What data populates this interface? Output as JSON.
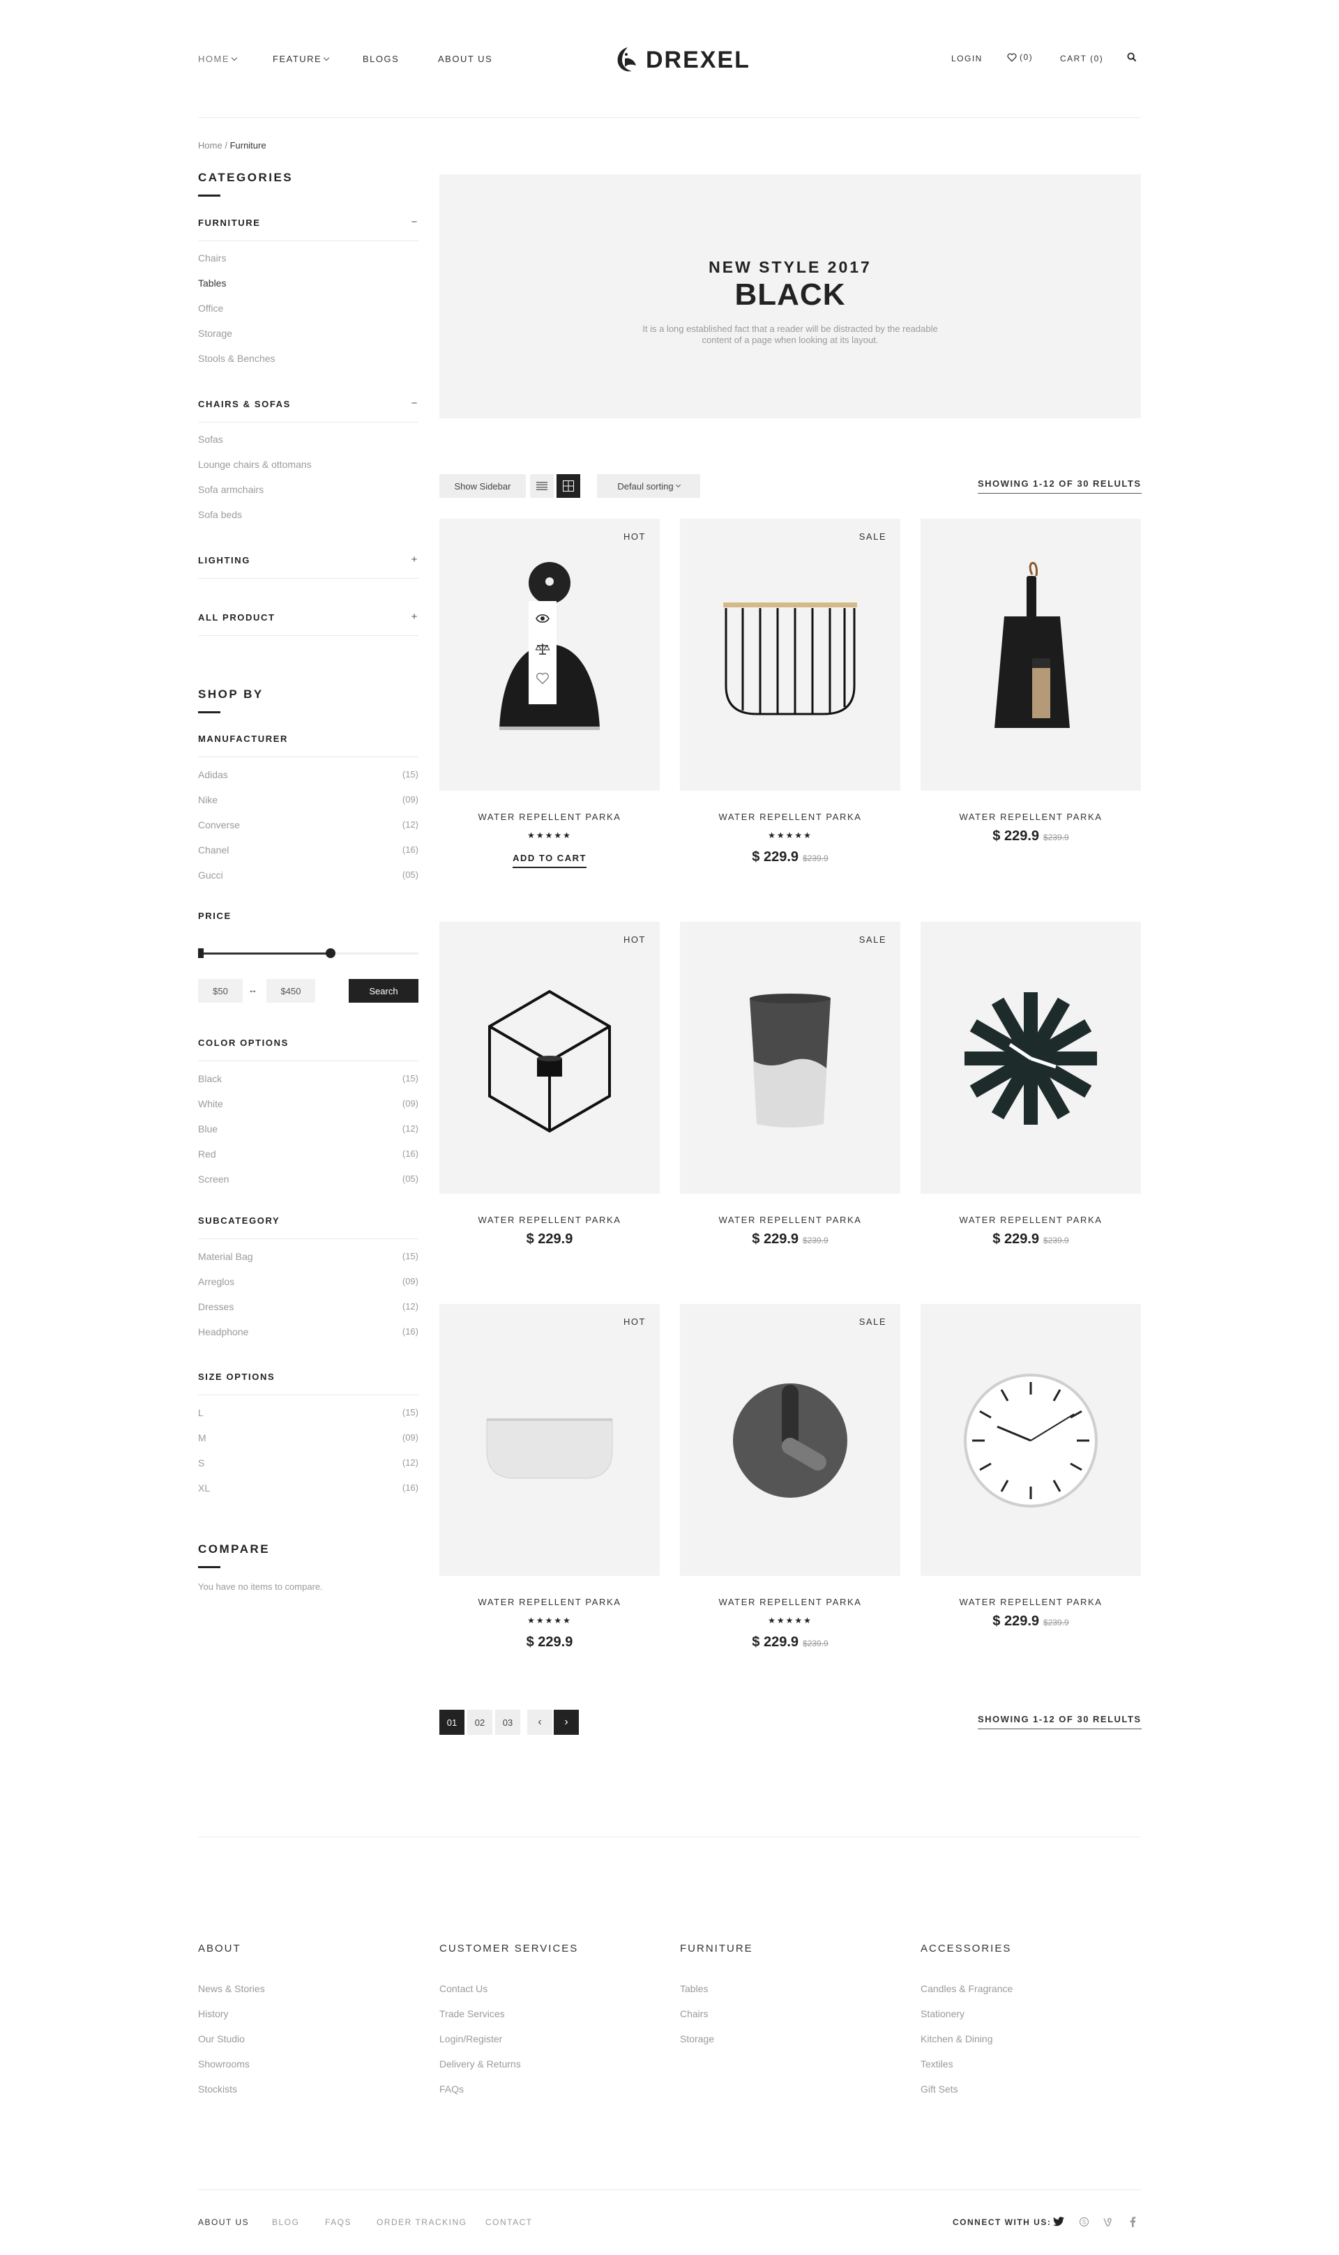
{
  "header": {
    "nav": [
      "HOME",
      "FEATURE",
      "BLOGS",
      "ABOUT US"
    ],
    "logo": "DREXEL",
    "login": "LOGIN",
    "wishlist": "(0)",
    "cart": "CART (0)",
    "icons": [
      "heart-icon",
      "search-icon",
      "logo-mark-icon"
    ]
  },
  "breadcrumb": {
    "home": "Home",
    "sep": "/",
    "current": "Furniture"
  },
  "sidebar": {
    "categories_title": "CATEGORIES",
    "groups": [
      {
        "title": "FURNITURE",
        "sign": "−",
        "items": [
          "Chairs",
          "Tables",
          "Office",
          "Storage",
          "Stools & Benches"
        ]
      },
      {
        "title": "CHAIRS & SOFAS",
        "sign": "−",
        "items": [
          "Sofas",
          "Lounge chairs & ottomans",
          "Sofa armchairs",
          "Sofa beds"
        ]
      },
      {
        "title": "LIGHTING",
        "sign": "+"
      },
      {
        "title": "ALL PRODUCT",
        "sign": "+"
      }
    ],
    "shop_by_title": "SHOP BY",
    "manufacturer": {
      "title": "MANUFACTURER",
      "items": [
        {
          "name": "Adidas",
          "count": "(15)"
        },
        {
          "name": "Nike",
          "count": "(09)"
        },
        {
          "name": "Converse",
          "count": "(12)"
        },
        {
          "name": "Chanel",
          "count": "(16)"
        },
        {
          "name": "Gucci",
          "count": "(05)"
        }
      ]
    },
    "price": {
      "title": "PRICE",
      "min": "$50",
      "sep": "↔",
      "max": "$450",
      "search_label": "Search",
      "range_fill": 0.6
    },
    "color": {
      "title": "COLOR OPTIONS",
      "items": [
        {
          "name": "Black",
          "count": "(15)"
        },
        {
          "name": "White",
          "count": "(09)"
        },
        {
          "name": "Blue",
          "count": "(12)"
        },
        {
          "name": "Red",
          "count": "(16)"
        },
        {
          "name": "Screen",
          "count": "(05)"
        }
      ]
    },
    "subcategory": {
      "title": "SUBCATEGORY",
      "items": [
        {
          "name": "Material Bag",
          "count": "(15)"
        },
        {
          "name": "Arreglos",
          "count": "(09)"
        },
        {
          "name": "Dresses",
          "count": "(12)"
        },
        {
          "name": "Headphone",
          "count": "(16)"
        }
      ]
    },
    "size": {
      "title": "SIZE OPTIONS",
      "items": [
        {
          "name": "L",
          "count": "(15)"
        },
        {
          "name": "M",
          "count": "(09)"
        },
        {
          "name": "S",
          "count": "(12)"
        },
        {
          "name": "XL",
          "count": "(16)"
        }
      ]
    },
    "compare": {
      "title": "COMPARE",
      "text": "You have no items to compare."
    }
  },
  "banner": {
    "subtitle": "NEW STYLE 2017",
    "title": "BLACK",
    "desc_line1": "It is a long established fact that a reader will be distracted by the readable",
    "desc_line2": "content of a page when looking at its layout."
  },
  "toolbar": {
    "show_sidebar": "Show Sidebar",
    "sort": "Defaul sorting",
    "showing": "SHOWING 1-12 OF 30 RELULTS",
    "active_view": "grid"
  },
  "products": [
    {
      "name": "WATER REPELLENT PARKA",
      "badge": "HOT",
      "stars": "★★★★★",
      "add_to_cart": "ADD TO CART",
      "image": "wall-lamp"
    },
    {
      "name": "WATER REPELLENT PARKA",
      "badge": "SALE",
      "stars": "★★★★★",
      "price": "$ 229.9",
      "old_price": "$239.9",
      "image": "wire-shelf"
    },
    {
      "name": "WATER REPELLENT PARKA",
      "price": "$ 229.9",
      "old_price": "$239.9",
      "image": "dustpan"
    },
    {
      "name": "WATER REPELLENT PARKA",
      "badge": "HOT",
      "price": "$ 229.9",
      "image": "cube-candle"
    },
    {
      "name": "WATER REPELLENT PARKA",
      "badge": "SALE",
      "price": "$ 229.9",
      "old_price": "$239.9",
      "image": "cup"
    },
    {
      "name": "WATER REPELLENT PARKA",
      "price": "$ 229.9",
      "old_price": "$239.9",
      "image": "asterisk-clock"
    },
    {
      "name": "WATER REPELLENT PARKA",
      "badge": "HOT",
      "stars": "★★★★★",
      "price": "$ 229.9",
      "image": "bowl-shelf"
    },
    {
      "name": "WATER REPELLENT PARKA",
      "badge": "SALE",
      "stars": "★★★★★",
      "price": "$ 229.9",
      "old_price": "$239.9",
      "image": "grey-clock"
    },
    {
      "name": "WATER REPELLENT PARKA",
      "price": "$ 229.9",
      "old_price": "$239.9",
      "image": "wall-clock"
    }
  ],
  "pagination": {
    "pages": [
      "01",
      "02",
      "03"
    ],
    "prev": "‹",
    "next": "›",
    "current": "01"
  },
  "footer": {
    "columns": [
      {
        "title": "ABOUT",
        "links": [
          "News & Stories",
          "History",
          "Our Studio",
          "Showrooms",
          "Stockists"
        ]
      },
      {
        "title": "CUSTOMER SERVICES",
        "links": [
          "Contact Us",
          "Trade Services",
          "Login/Register",
          "Delivery & Returns",
          "FAQs"
        ]
      },
      {
        "title": "FURNITURE",
        "links": [
          "Tables",
          "Chairs",
          "Storage"
        ]
      },
      {
        "title": "ACCESSORIES",
        "links": [
          "Candles & Fragrance",
          "Stationery",
          "Kitchen & Dining",
          "Textiles",
          "Gift Sets"
        ]
      }
    ],
    "bottom_links": [
      "ABOUT US",
      "BLOG",
      "FAQS",
      "ORDER TRACKING",
      "CONTACT"
    ],
    "connect": "CONNECT WITH US:",
    "social_icons": [
      "twitter-icon",
      "skype-icon",
      "vine-icon",
      "facebook-icon"
    ]
  },
  "colors": {
    "dark": "#222222",
    "panel": "#f3f3f3",
    "muted": "#9a9a9a"
  }
}
